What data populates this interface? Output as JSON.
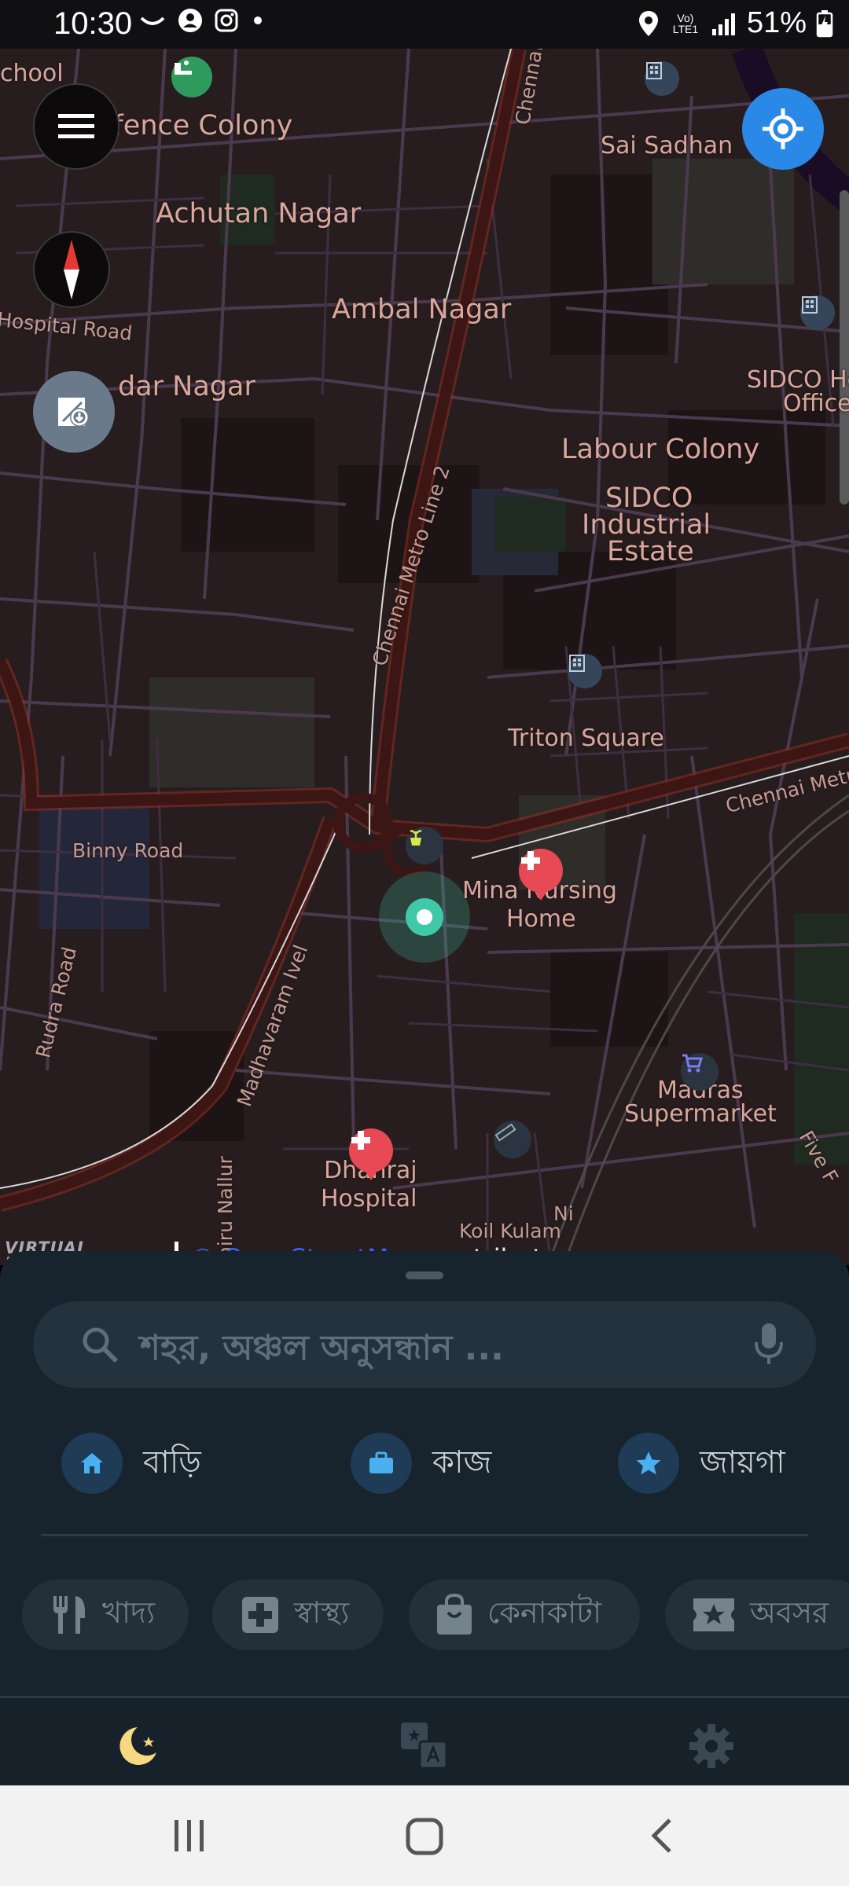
{
  "status_bar": {
    "time": "10:30",
    "battery": "51%",
    "network": "Vo) LTE1"
  },
  "map": {
    "labels": {
      "school": "chool",
      "defence_colony": "Defence Colony",
      "achutan_nagar": "Achutan Nagar",
      "ambal_nagar": "Ambal Nagar",
      "hospital_road": "Hospital Road",
      "dar_nagar": "dar Nagar",
      "sai_sadhan": "Sai Sadhan",
      "sidco_office_1": "SIDCO He",
      "sidco_office_2": "Office",
      "labour_colony": "Labour Colony",
      "sidco_estate_1": "SIDCO",
      "sidco_estate_2": "Industrial",
      "sidco_estate_3": "Estate",
      "chennai_top": "Chennai",
      "metro_line": "Chennai Metro Line 2",
      "triton_square": "Triton Square",
      "chennai_metro_right": "Chennai Metr",
      "binny_road": "Binny Road",
      "mina_1": "Mina Nursing",
      "mina_2": "Home",
      "rudra_road": "Rudra Road",
      "madhavaram": "Madhavaram Ivel",
      "madras_1": "Madras",
      "madras_2": "Supermarket",
      "five": "Five F",
      "dhanraj_1": "Dhanraj",
      "dhanraj_2": "Hospital",
      "koil_kulam_1": "Ni",
      "koil_kulam_2": "Koil Kulam",
      "nallur": "hiru Nallur"
    },
    "attribution": {
      "brand": "VIRTUAL MAZE",
      "link": "© OpenStreetMap",
      "suffix": " contributors"
    },
    "accent": "#2a88e6"
  },
  "sheet": {
    "search_placeholder": "শহর, অঞ্চল অনুসন্ধান ...",
    "quick": {
      "home": "বাড়ি",
      "work": "কাজ",
      "places": "জায়গা"
    },
    "chips": {
      "food": "খাদ্য",
      "health": "স্বাস্থ্য",
      "shopping": "কেনাকাটা",
      "leisure": "অবসর"
    }
  },
  "icons": {
    "menu": "menu-icon",
    "compass": "compass-icon",
    "download_map": "download-map-icon",
    "locate": "my-location-icon",
    "night_mode": "moon-icon",
    "translate": "translate-icon",
    "settings": "gear-icon"
  }
}
